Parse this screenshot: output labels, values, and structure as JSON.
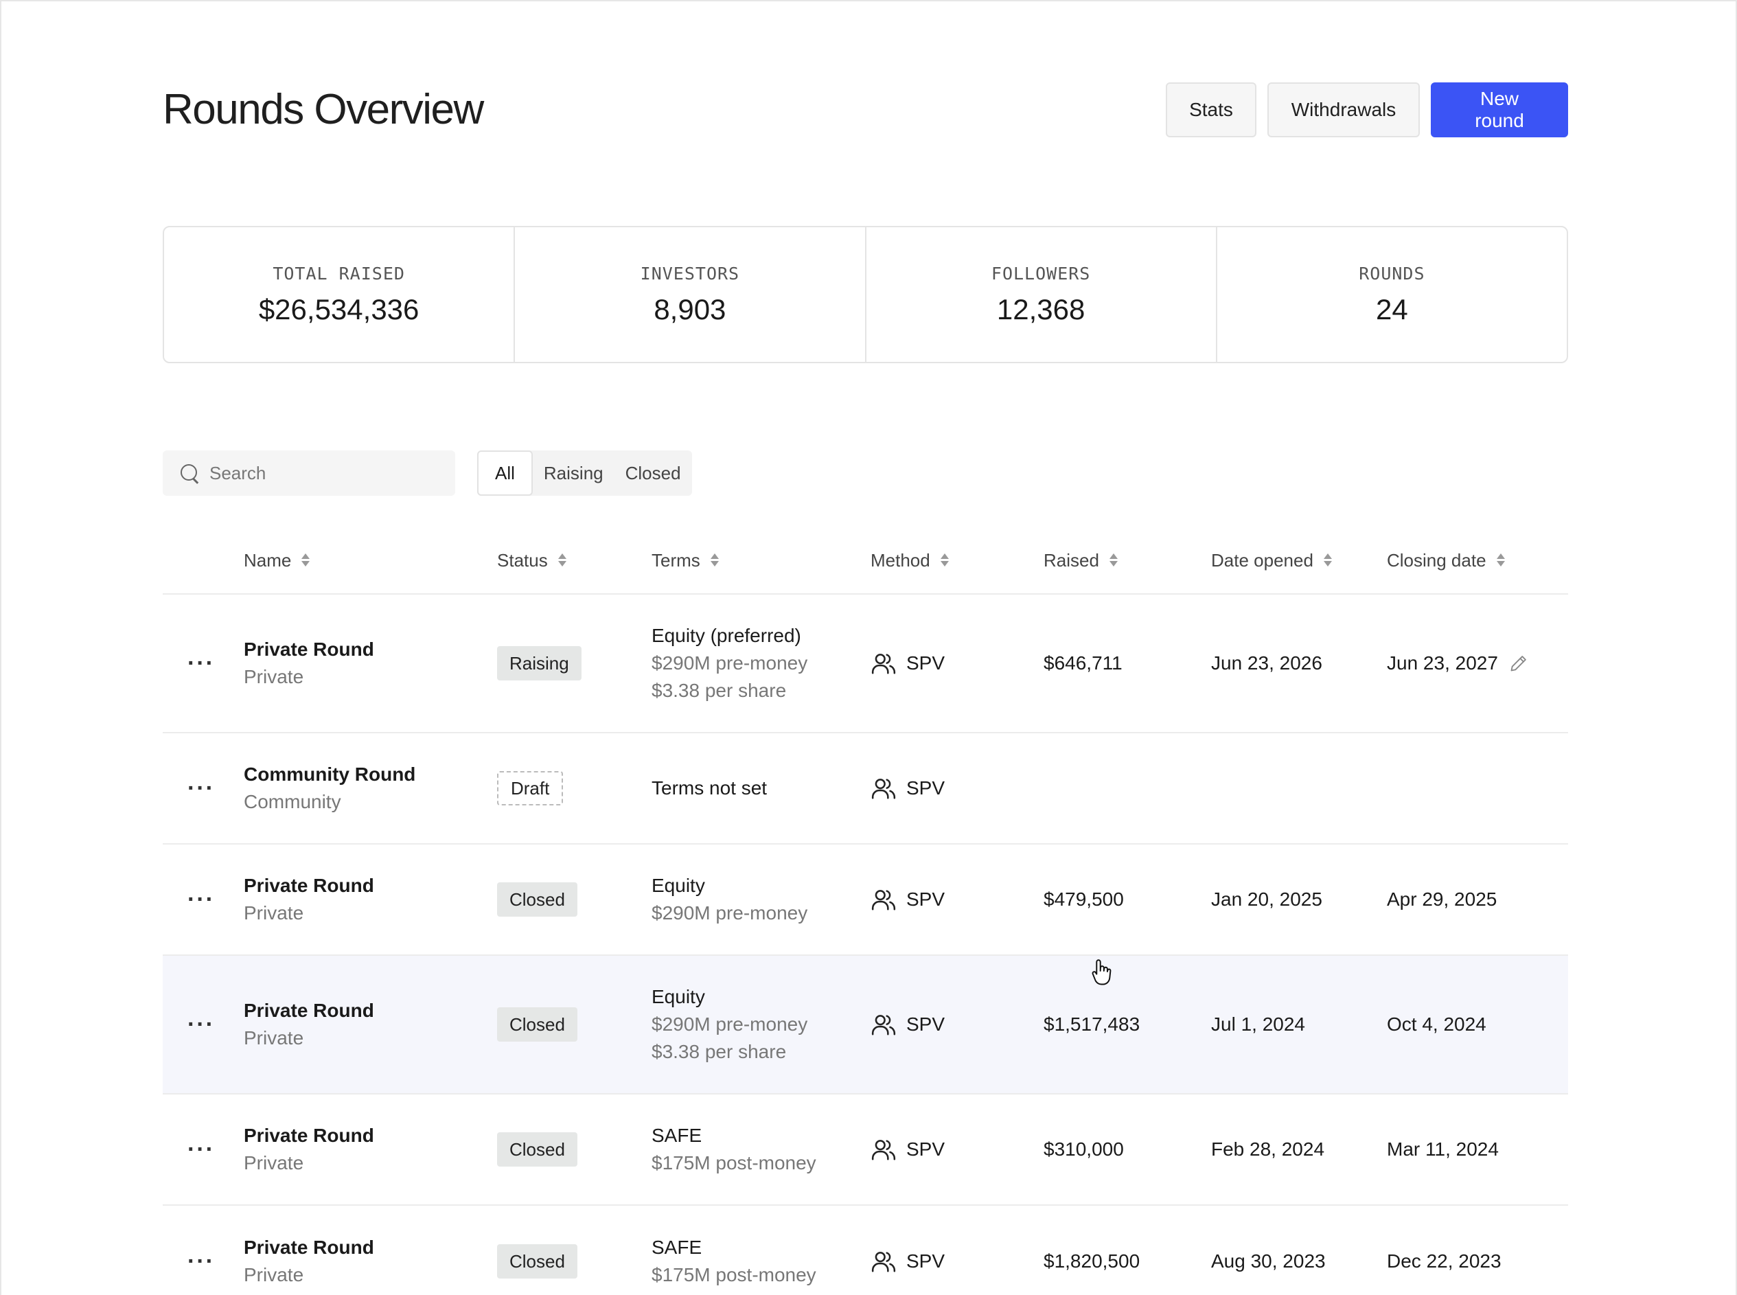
{
  "header": {
    "title": "Rounds Overview",
    "actions": {
      "stats": "Stats",
      "withdrawals": "Withdrawals",
      "new_round": "New round"
    }
  },
  "stats": [
    {
      "label": "TOTAL RAISED",
      "value": "$26,534,336"
    },
    {
      "label": "INVESTORS",
      "value": "8,903"
    },
    {
      "label": "FOLLOWERS",
      "value": "12,368"
    },
    {
      "label": "ROUNDS",
      "value": "24"
    }
  ],
  "search": {
    "placeholder": "Search",
    "value": ""
  },
  "filters": {
    "all": "All",
    "raising": "Raising",
    "closed": "Closed",
    "selected": "All"
  },
  "table": {
    "columns": {
      "name": "Name",
      "status": "Status",
      "terms": "Terms",
      "method": "Method",
      "raised": "Raised",
      "date_opened": "Date opened",
      "closing_date": "Closing date"
    },
    "rows": [
      {
        "name": "Private Round",
        "type": "Private",
        "status": "Raising",
        "terms": [
          "Equity (preferred)",
          "$290M pre-money",
          "$3.38 per share"
        ],
        "method": "SPV",
        "raised": "$646,711",
        "date_opened": "Jun 23, 2026",
        "closing_date": "Jun 23, 2027"
      },
      {
        "name": "Community Round",
        "type": "Community",
        "status": "Draft",
        "terms": [
          "Terms not set"
        ],
        "method": "SPV",
        "raised": "",
        "date_opened": "",
        "closing_date": ""
      },
      {
        "name": "Private Round",
        "type": "Private",
        "status": "Closed",
        "terms": [
          "Equity",
          "$290M pre-money"
        ],
        "method": "SPV",
        "raised": "$479,500",
        "date_opened": "Jan 20, 2025",
        "closing_date": "Apr 29, 2025"
      },
      {
        "name": "Private Round",
        "type": "Private",
        "status": "Closed",
        "terms": [
          "Equity",
          "$290M pre-money",
          "$3.38 per share"
        ],
        "method": "SPV",
        "raised": "$1,517,483",
        "date_opened": "Jul 1, 2024",
        "closing_date": "Oct 4, 2024"
      },
      {
        "name": "Private Round",
        "type": "Private",
        "status": "Closed",
        "terms": [
          "SAFE",
          "$175M post-money"
        ],
        "method": "SPV",
        "raised": "$310,000",
        "date_opened": "Feb 28, 2024",
        "closing_date": "Mar 11, 2024"
      },
      {
        "name": "Private Round",
        "type": "Private",
        "status": "Closed",
        "terms": [
          "SAFE",
          "$175M post-money"
        ],
        "method": "SPV",
        "raised": "$1,820,500",
        "date_opened": "Aug 30, 2023",
        "closing_date": "Dec 22, 2023"
      }
    ]
  },
  "colors": {
    "primary": "#3b54f5",
    "hover_row": "#f5f6fc",
    "badge_bg": "#e5e7e6"
  },
  "icons": {
    "more": "more-horizontal-icon",
    "method": "users-icon",
    "edit": "pencil-icon",
    "sort": "sort-icon",
    "search": "search-icon"
  }
}
